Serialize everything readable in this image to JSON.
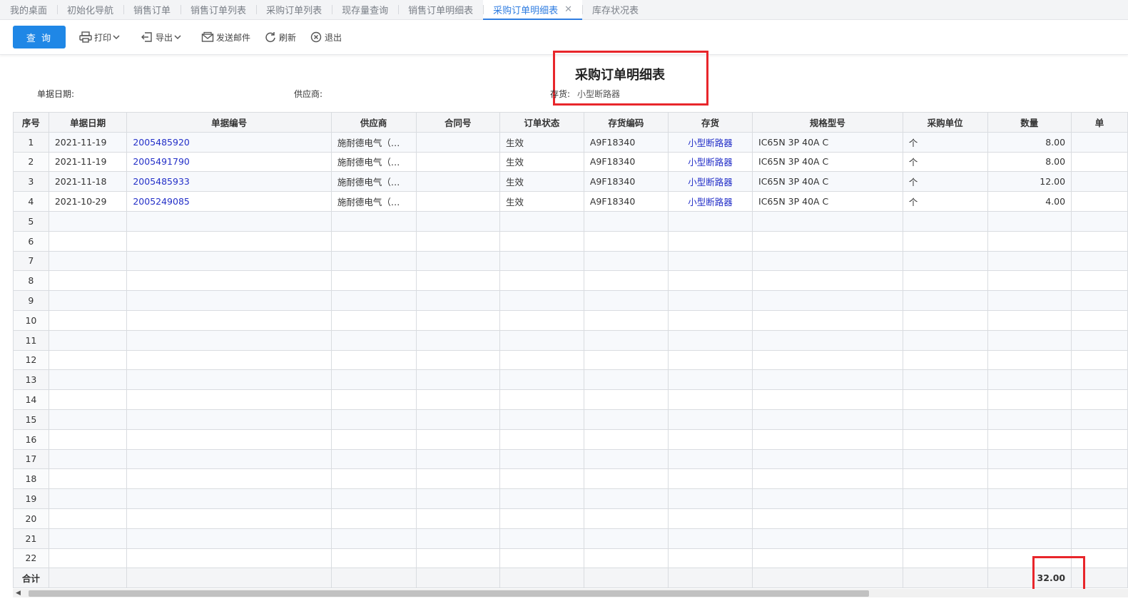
{
  "tabs": [
    {
      "label": "我的桌面"
    },
    {
      "label": "初始化导航"
    },
    {
      "label": "销售订单"
    },
    {
      "label": "销售订单列表"
    },
    {
      "label": "采购订单列表"
    },
    {
      "label": "现存量查询"
    },
    {
      "label": "销售订单明细表"
    },
    {
      "label": "采购订单明细表",
      "active": true
    },
    {
      "label": "库存状况表"
    }
  ],
  "tab_close_glyph": "✕",
  "toolbar": {
    "query_label": "查 询",
    "print_label": "打印",
    "export_label": "导出",
    "email_label": "发送邮件",
    "refresh_label": "刷新",
    "exit_label": "退出"
  },
  "report": {
    "title": "采购订单明细表",
    "filters": {
      "date_label": "单据日期:",
      "supplier_label": "供应商:",
      "inventory_label": "存货:",
      "inventory_value": "小型断路器"
    }
  },
  "table": {
    "columns": [
      "序号",
      "单据日期",
      "单据编号",
      "供应商",
      "合同号",
      "订单状态",
      "存货编码",
      "存货",
      "规格型号",
      "采购单位",
      "数量",
      "单"
    ],
    "rows": [
      {
        "seq": "1",
        "date": "2021-11-19",
        "doc_no": "2005485920",
        "supplier": "施耐德电气（…",
        "contract": "",
        "status": "生效",
        "code": "A9F18340",
        "item": "小型断路器",
        "spec": "IC65N 3P 40A C",
        "unit": "个",
        "qty": "8.00"
      },
      {
        "seq": "2",
        "date": "2021-11-19",
        "doc_no": "2005491790",
        "supplier": "施耐德电气（…",
        "contract": "",
        "status": "生效",
        "code": "A9F18340",
        "item": "小型断路器",
        "spec": "IC65N 3P 40A C",
        "unit": "个",
        "qty": "8.00"
      },
      {
        "seq": "3",
        "date": "2021-11-18",
        "doc_no": "2005485933",
        "supplier": "施耐德电气（…",
        "contract": "",
        "status": "生效",
        "code": "A9F18340",
        "item": "小型断路器",
        "spec": "IC65N 3P 40A C",
        "unit": "个",
        "qty": "12.00"
      },
      {
        "seq": "4",
        "date": "2021-10-29",
        "doc_no": "2005249085",
        "supplier": "施耐德电气（…",
        "contract": "",
        "status": "生效",
        "code": "A9F18340",
        "item": "小型断路器",
        "spec": "IC65N 3P 40A C",
        "unit": "个",
        "qty": "4.00"
      }
    ],
    "empty_row_numbers": [
      "5",
      "6",
      "7",
      "8",
      "9",
      "10",
      "11",
      "12",
      "13",
      "14",
      "15",
      "16",
      "17",
      "18",
      "19",
      "20",
      "21",
      "22"
    ],
    "total_label": "合计",
    "total_qty": "32.00"
  },
  "colors": {
    "accent": "#1f87e6",
    "active_tab": "#2f7de1",
    "link": "#2430c8",
    "highlight_box": "#e8262b"
  }
}
